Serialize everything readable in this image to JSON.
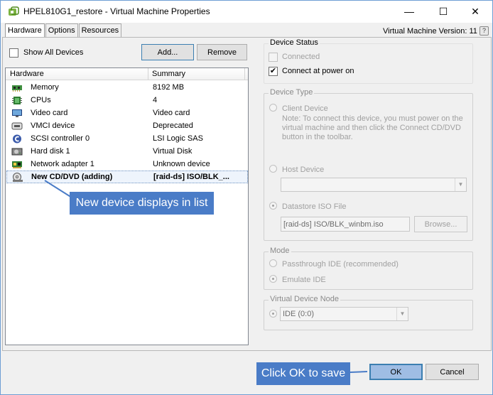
{
  "window": {
    "title": "HPEL810G1_restore - Virtual Machine Properties",
    "controls": {
      "minimize": "—",
      "maximize": "☐",
      "close": "✕"
    }
  },
  "tabs": [
    {
      "label": "Hardware",
      "active": true
    },
    {
      "label": "Options",
      "active": false
    },
    {
      "label": "Resources",
      "active": false
    }
  ],
  "vm_version": "Virtual Machine Version: 11",
  "help": "?",
  "left": {
    "show_all_devices": {
      "label": "Show All Devices",
      "checked": false
    },
    "add_label": "Add...",
    "remove_label": "Remove",
    "columns": [
      "Hardware",
      "Summary"
    ],
    "rows": [
      {
        "icon": "memory-icon",
        "name": "Memory",
        "summary": "8192 MB"
      },
      {
        "icon": "cpu-icon",
        "name": "CPUs",
        "summary": "4"
      },
      {
        "icon": "video-card-icon",
        "name": "Video card",
        "summary": "Video card"
      },
      {
        "icon": "vmci-device-icon",
        "name": "VMCI device",
        "summary": "Deprecated"
      },
      {
        "icon": "scsi-controller-icon",
        "name": "SCSI controller 0",
        "summary": "LSI Logic SAS"
      },
      {
        "icon": "hard-disk-icon",
        "name": "Hard disk 1",
        "summary": "Virtual Disk"
      },
      {
        "icon": "network-adapter-icon",
        "name": "Network adapter 1",
        "summary": "Unknown device"
      },
      {
        "icon": "cd-dvd-icon",
        "name": "New CD/DVD (adding)",
        "summary": "[raid-ds] ISO/BLK_...",
        "selected": true
      }
    ]
  },
  "callouts": {
    "list": "New device displays in list",
    "ok": "Click OK to save"
  },
  "right": {
    "device_status": {
      "title": "Device Status",
      "connected": {
        "label": "Connected",
        "checked": false,
        "enabled": false
      },
      "connect_power_on": {
        "label": "Connect at power on",
        "checked": true,
        "enabled": true
      },
      "check_glyph": "✔"
    },
    "device_type": {
      "title": "Device Type",
      "client_device": "Client Device",
      "note": "Note: To connect this device, you must power on the virtual machine and then click the Connect CD/DVD button in the toolbar.",
      "host_device": "Host Device",
      "host_device_value": "",
      "datastore_iso": "Datastore ISO File",
      "iso_path": "[raid-ds] ISO/BLK_winbm.iso",
      "browse_label": "Browse..."
    },
    "mode": {
      "title": "Mode",
      "passthrough": "Passthrough IDE (recommended)",
      "emulate": "Emulate IDE"
    },
    "virtual_device_node": {
      "title": "Virtual Device Node",
      "value": "IDE (0:0)"
    }
  },
  "footer": {
    "ok_label": "OK",
    "cancel_label": "Cancel"
  },
  "colors": {
    "callout": "#4a7cc7",
    "title_border": "#6e9ed4"
  }
}
